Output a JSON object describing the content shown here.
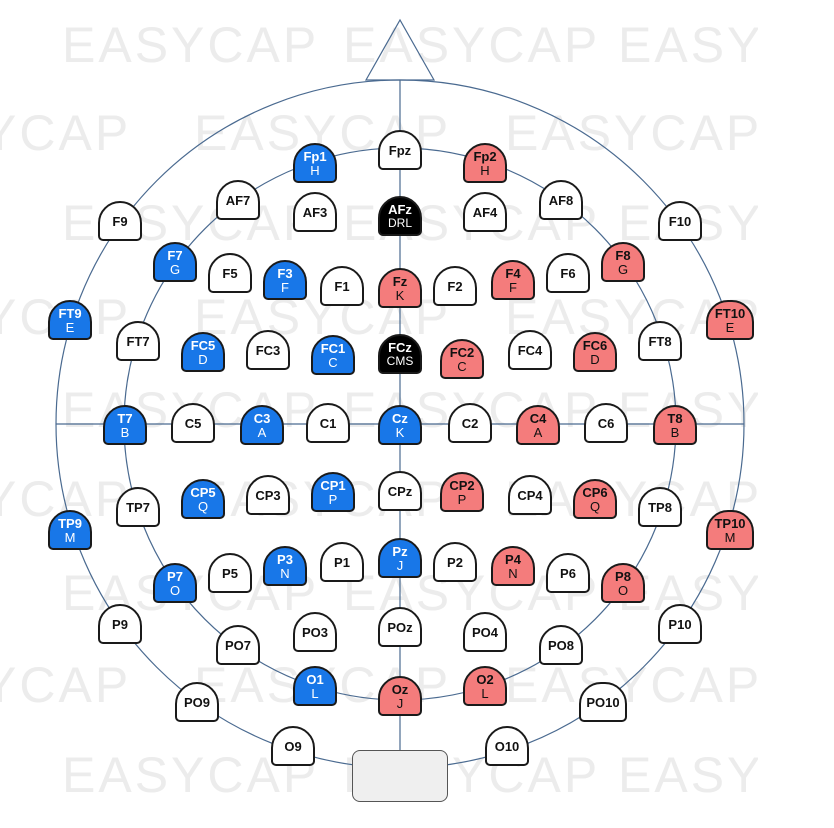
{
  "watermark": "EASYCAP",
  "colors": {
    "line": "#4a6a90",
    "blue": "#1877e8",
    "red": "#f47c7c",
    "black": "#000000",
    "white": "#ffffff"
  },
  "electrodes": [
    {
      "id": "Fpz",
      "label": "Fpz",
      "sub": "",
      "color": "white"
    },
    {
      "id": "Fp1",
      "label": "Fp1",
      "sub": "H",
      "color": "blue"
    },
    {
      "id": "Fp2",
      "label": "Fp2",
      "sub": "H",
      "color": "red"
    },
    {
      "id": "AF7",
      "label": "AF7",
      "sub": "",
      "color": "white"
    },
    {
      "id": "AF3",
      "label": "AF3",
      "sub": "",
      "color": "white"
    },
    {
      "id": "AFz",
      "label": "AFz",
      "sub": "DRL",
      "color": "black"
    },
    {
      "id": "AF4",
      "label": "AF4",
      "sub": "",
      "color": "white"
    },
    {
      "id": "AF8",
      "label": "AF8",
      "sub": "",
      "color": "white"
    },
    {
      "id": "F9",
      "label": "F9",
      "sub": "",
      "color": "white"
    },
    {
      "id": "F10",
      "label": "F10",
      "sub": "",
      "color": "white"
    },
    {
      "id": "F7",
      "label": "F7",
      "sub": "G",
      "color": "blue"
    },
    {
      "id": "F5",
      "label": "F5",
      "sub": "",
      "color": "white"
    },
    {
      "id": "F3",
      "label": "F3",
      "sub": "F",
      "color": "blue"
    },
    {
      "id": "F1",
      "label": "F1",
      "sub": "",
      "color": "white"
    },
    {
      "id": "Fz",
      "label": "Fz",
      "sub": "K",
      "color": "red"
    },
    {
      "id": "F2",
      "label": "F2",
      "sub": "",
      "color": "white"
    },
    {
      "id": "F4",
      "label": "F4",
      "sub": "F",
      "color": "red"
    },
    {
      "id": "F6",
      "label": "F6",
      "sub": "",
      "color": "white"
    },
    {
      "id": "F8",
      "label": "F8",
      "sub": "G",
      "color": "red"
    },
    {
      "id": "FT9",
      "label": "FT9",
      "sub": "E",
      "color": "blue"
    },
    {
      "id": "FT10",
      "label": "FT10",
      "sub": "E",
      "color": "red"
    },
    {
      "id": "FT7",
      "label": "FT7",
      "sub": "",
      "color": "white"
    },
    {
      "id": "FC5",
      "label": "FC5",
      "sub": "D",
      "color": "blue"
    },
    {
      "id": "FC3",
      "label": "FC3",
      "sub": "",
      "color": "white"
    },
    {
      "id": "FC1",
      "label": "FC1",
      "sub": "C",
      "color": "blue"
    },
    {
      "id": "FCz",
      "label": "FCz",
      "sub": "CMS",
      "color": "black"
    },
    {
      "id": "FC2",
      "label": "FC2",
      "sub": "C",
      "color": "red"
    },
    {
      "id": "FC4",
      "label": "FC4",
      "sub": "",
      "color": "white"
    },
    {
      "id": "FC6",
      "label": "FC6",
      "sub": "D",
      "color": "red"
    },
    {
      "id": "FT8",
      "label": "FT8",
      "sub": "",
      "color": "white"
    },
    {
      "id": "T7",
      "label": "T7",
      "sub": "B",
      "color": "blue"
    },
    {
      "id": "C5",
      "label": "C5",
      "sub": "",
      "color": "white"
    },
    {
      "id": "C3",
      "label": "C3",
      "sub": "A",
      "color": "blue"
    },
    {
      "id": "C1",
      "label": "C1",
      "sub": "",
      "color": "white"
    },
    {
      "id": "Cz",
      "label": "Cz",
      "sub": "K",
      "color": "blue"
    },
    {
      "id": "C2",
      "label": "C2",
      "sub": "",
      "color": "white"
    },
    {
      "id": "C4",
      "label": "C4",
      "sub": "A",
      "color": "red"
    },
    {
      "id": "C6",
      "label": "C6",
      "sub": "",
      "color": "white"
    },
    {
      "id": "T8",
      "label": "T8",
      "sub": "B",
      "color": "red"
    },
    {
      "id": "TP9",
      "label": "TP9",
      "sub": "M",
      "color": "blue"
    },
    {
      "id": "TP7",
      "label": "TP7",
      "sub": "",
      "color": "white"
    },
    {
      "id": "CP5",
      "label": "CP5",
      "sub": "Q",
      "color": "blue"
    },
    {
      "id": "CP3",
      "label": "CP3",
      "sub": "",
      "color": "white"
    },
    {
      "id": "CP1",
      "label": "CP1",
      "sub": "P",
      "color": "blue"
    },
    {
      "id": "CPz",
      "label": "CPz",
      "sub": "",
      "color": "white"
    },
    {
      "id": "CP2",
      "label": "CP2",
      "sub": "P",
      "color": "red"
    },
    {
      "id": "CP4",
      "label": "CP4",
      "sub": "",
      "color": "white"
    },
    {
      "id": "CP6",
      "label": "CP6",
      "sub": "Q",
      "color": "red"
    },
    {
      "id": "TP8",
      "label": "TP8",
      "sub": "",
      "color": "white"
    },
    {
      "id": "TP10",
      "label": "TP10",
      "sub": "M",
      "color": "red"
    },
    {
      "id": "P7",
      "label": "P7",
      "sub": "O",
      "color": "blue"
    },
    {
      "id": "P5",
      "label": "P5",
      "sub": "",
      "color": "white"
    },
    {
      "id": "P3",
      "label": "P3",
      "sub": "N",
      "color": "blue"
    },
    {
      "id": "P1",
      "label": "P1",
      "sub": "",
      "color": "white"
    },
    {
      "id": "Pz",
      "label": "Pz",
      "sub": "J",
      "color": "blue"
    },
    {
      "id": "P2",
      "label": "P2",
      "sub": "",
      "color": "white"
    },
    {
      "id": "P4",
      "label": "P4",
      "sub": "N",
      "color": "red"
    },
    {
      "id": "P6",
      "label": "P6",
      "sub": "",
      "color": "white"
    },
    {
      "id": "P8",
      "label": "P8",
      "sub": "O",
      "color": "red"
    },
    {
      "id": "P9",
      "label": "P9",
      "sub": "",
      "color": "white"
    },
    {
      "id": "P10",
      "label": "P10",
      "sub": "",
      "color": "white"
    },
    {
      "id": "PO7",
      "label": "PO7",
      "sub": "",
      "color": "white"
    },
    {
      "id": "PO3",
      "label": "PO3",
      "sub": "",
      "color": "white"
    },
    {
      "id": "POz",
      "label": "POz",
      "sub": "",
      "color": "white"
    },
    {
      "id": "PO4",
      "label": "PO4",
      "sub": "",
      "color": "white"
    },
    {
      "id": "PO8",
      "label": "PO8",
      "sub": "",
      "color": "white"
    },
    {
      "id": "PO9",
      "label": "PO9",
      "sub": "",
      "color": "white"
    },
    {
      "id": "PO10",
      "label": "PO10",
      "sub": "",
      "color": "white"
    },
    {
      "id": "O1",
      "label": "O1",
      "sub": "L",
      "color": "blue"
    },
    {
      "id": "Oz",
      "label": "Oz",
      "sub": "J",
      "color": "red"
    },
    {
      "id": "O2",
      "label": "O2",
      "sub": "L",
      "color": "red"
    },
    {
      "id": "O9",
      "label": "O9",
      "sub": "",
      "color": "white"
    },
    {
      "id": "O10",
      "label": "O10",
      "sub": "",
      "color": "white"
    }
  ]
}
